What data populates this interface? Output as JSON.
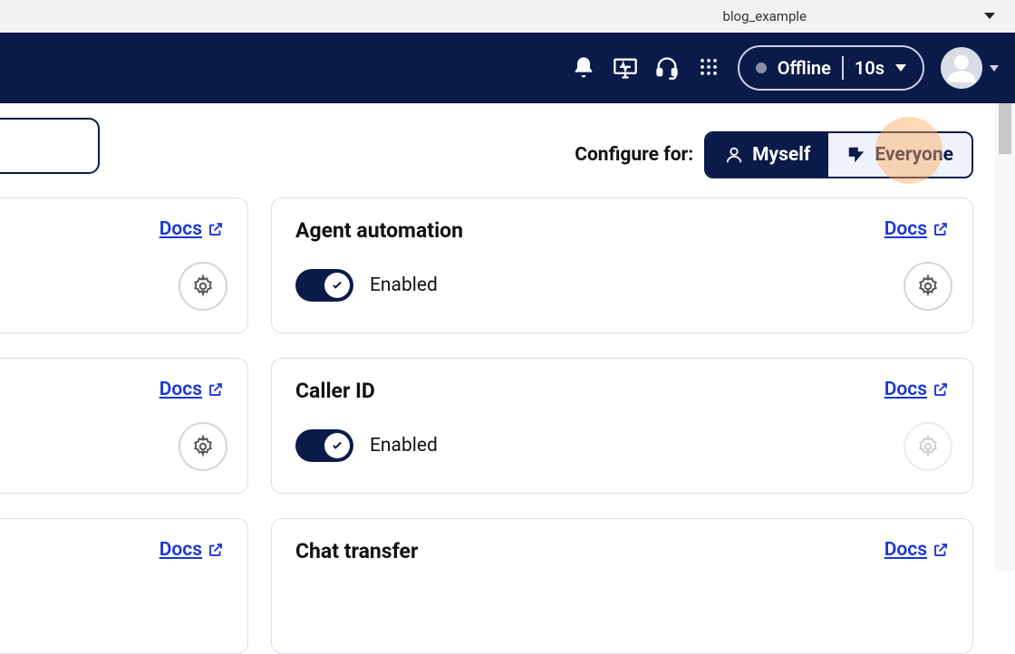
{
  "topbar": {
    "environment": "blog_example"
  },
  "navbar": {
    "status_label": "Offline",
    "status_time": "10s"
  },
  "configure": {
    "label": "Configure for:",
    "myself": "Myself",
    "everyone": "Everyone"
  },
  "common": {
    "docs_label": "Docs",
    "toggle_enabled_label": "Enabled"
  },
  "cards": {
    "agent_automation": {
      "title": "Agent automation"
    },
    "caller_id": {
      "title": "Caller ID"
    },
    "chat_transfer": {
      "title": "Chat transfer"
    }
  }
}
